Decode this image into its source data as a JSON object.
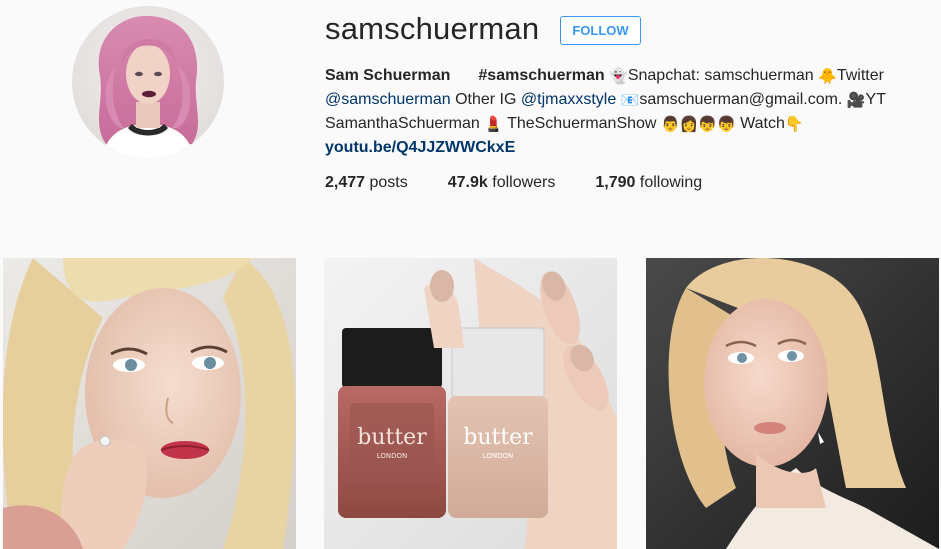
{
  "profile": {
    "username": "samschuerman",
    "follow_label": "FOLLOW",
    "full_name": "Sam Schuerman",
    "bio_parts": {
      "hashtag": "#samschuerman",
      "ghost_emoji": "👻",
      "snapchat_text": "Snapchat: samschuerman",
      "bird_emoji": "🐥",
      "twitter_text": "Twitter",
      "twitter_handle": "@samschuerman",
      "other_ig_text": "Other IG",
      "other_ig_handle": "@tjmaxxstyle",
      "email_emoji": "📧",
      "email": "samschuerman@gmail.com.",
      "camera_emoji": "🎥",
      "yt_text": "YT",
      "channel_name": "SamanthaSchuerman",
      "lipstick_emoji": "💄",
      "show_name": "TheSchuermanShow",
      "family_emojis": "👨👩👦👦",
      "watch_text": "Watch",
      "point_down_emoji": "👇",
      "youtube_link": "youtu.be/Q4JJZWWCkxE"
    }
  },
  "stats": {
    "posts_count": "2,477",
    "posts_label": "posts",
    "followers_count": "47.9k",
    "followers_label": "followers",
    "following_count": "1,790",
    "following_label": "following"
  },
  "posts": [
    {
      "kind": "selfie-portrait"
    },
    {
      "kind": "nail-polish-bottles",
      "brand_text": "butter",
      "sub_text": "LONDON"
    },
    {
      "kind": "selfie-side"
    }
  ],
  "colors": {
    "link_blue": "#3897f0",
    "mention_dark": "#003569",
    "text": "#262626",
    "background": "#fafafa"
  }
}
